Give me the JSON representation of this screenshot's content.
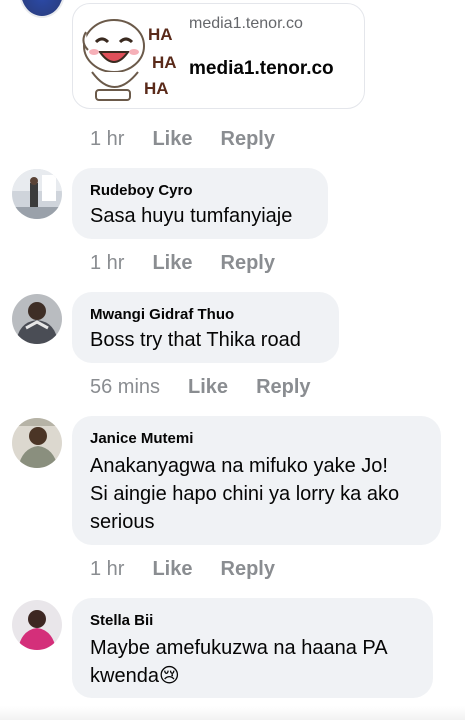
{
  "link_preview": {
    "domain_small": "media1.tenor.co",
    "domain_big": "media1.tenor.co",
    "thumb_text": [
      "HA",
      "HA",
      "HA"
    ]
  },
  "link_meta": {
    "time": "1 hr",
    "like": "Like",
    "reply": "Reply"
  },
  "comments": [
    {
      "author": "Rudeboy Cyro",
      "lines": [
        "Sasa huyu tumfanyiaje"
      ],
      "time": "1 hr",
      "like": "Like",
      "reply": "Reply"
    },
    {
      "author": "Mwangi Gidraf Thuo",
      "lines": [
        "Boss try that Thika road"
      ],
      "time": "56 mins",
      "like": "Like",
      "reply": "Reply"
    },
    {
      "author": "Janice Mutemi",
      "lines": [
        "Anakanyagwa na mifuko yake Jo!",
        "Si aingie hapo chini ya lorry ka ako",
        "serious"
      ],
      "time": "1 hr",
      "like": "Like",
      "reply": "Reply"
    },
    {
      "author": "Stella Bii",
      "lines": [
        "Maybe amefukuzwa na haana PA",
        "kwenda😢"
      ]
    }
  ]
}
